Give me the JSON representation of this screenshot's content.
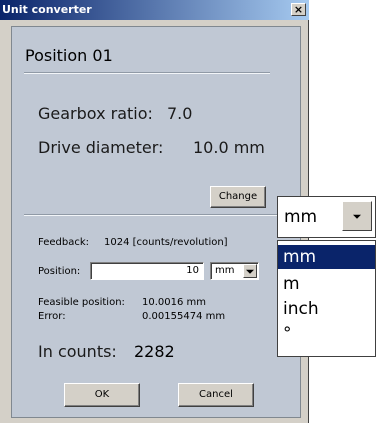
{
  "window": {
    "title": "Unit converter",
    "close_glyph": "×"
  },
  "position_title": "Position 01",
  "gearbox": {
    "label": "Gearbox ratio:",
    "value": "7.0"
  },
  "drive": {
    "label": "Drive diameter:",
    "value": "10.0 mm"
  },
  "change_button": "Change",
  "feedback": {
    "label": "Feedback:",
    "value": "1024 [counts/revolution]"
  },
  "position": {
    "label": "Position:",
    "value": "10",
    "unit": "mm"
  },
  "feasible": {
    "label": "Feasible position:",
    "value": "10.0016 mm"
  },
  "error": {
    "label": "Error:",
    "value": "0.00155474 mm"
  },
  "counts": {
    "label": "In counts:",
    "value": "2282"
  },
  "buttons": {
    "ok": "OK",
    "cancel": "Cancel"
  },
  "unit_dropdown": {
    "selected": "mm",
    "options": [
      "mm",
      "m",
      "inch",
      "°"
    ]
  }
}
